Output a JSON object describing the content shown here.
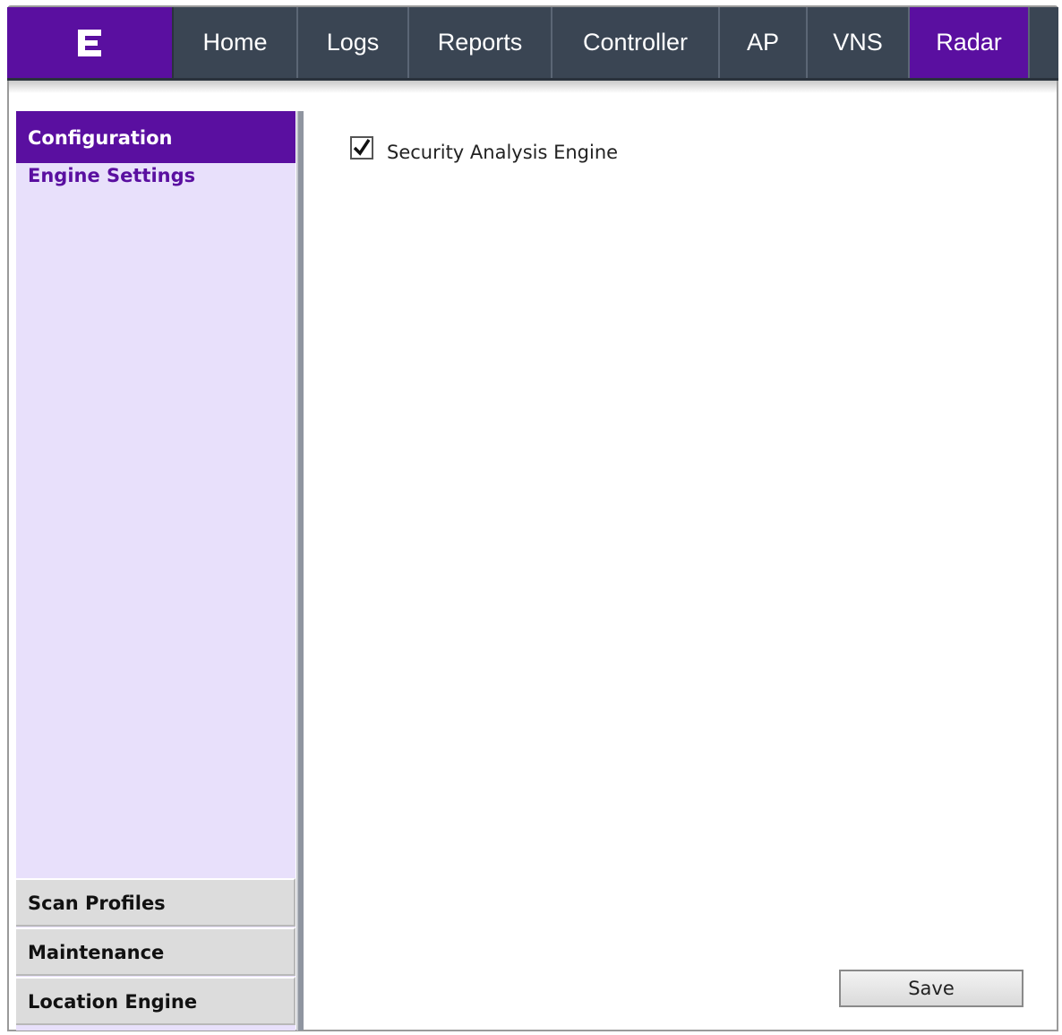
{
  "nav": {
    "logo_icon": "extreme-logo-icon",
    "tabs": [
      {
        "label": "Home"
      },
      {
        "label": "Logs"
      },
      {
        "label": "Reports"
      },
      {
        "label": "Controller"
      },
      {
        "label": "AP"
      },
      {
        "label": "VNS"
      },
      {
        "label": "Radar",
        "active": true
      }
    ]
  },
  "sidebar": {
    "header": "Configuration",
    "sub_item": "Engine Settings",
    "sections": [
      "Scan Profiles",
      "Maintenance",
      "Location Engine"
    ]
  },
  "content": {
    "checkbox_label": "Security Analysis Engine",
    "checkbox_checked": true,
    "save_label": "Save"
  },
  "colors": {
    "brand_purple": "#5a0fa0",
    "nav_bg": "#3a4553",
    "sidebar_bg": "#e8e0fb"
  }
}
